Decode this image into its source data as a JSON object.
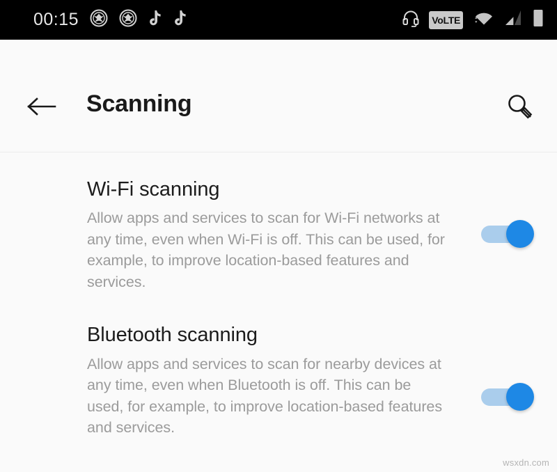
{
  "status_bar": {
    "clock": "00:15",
    "left_icons": [
      {
        "name": "shield-emblem-icon"
      },
      {
        "name": "shield-emblem-icon"
      },
      {
        "name": "tiktok-note-icon"
      },
      {
        "name": "tiktok-note-icon"
      }
    ],
    "right_icons": [
      {
        "name": "headset-icon"
      },
      {
        "name": "volte-badge",
        "label": "VoLTE"
      },
      {
        "name": "wifi-icon"
      },
      {
        "name": "cellular-signal-icon"
      },
      {
        "name": "battery-icon"
      }
    ],
    "background_color": "#000000",
    "foreground_color": "#e0e0e0"
  },
  "app_bar": {
    "back_label": "Back",
    "title": "Scanning",
    "search_label": "Search"
  },
  "settings": {
    "items": [
      {
        "title": "Wi-Fi scanning",
        "summary": "Allow apps and services to scan for Wi-Fi networks at any time, even when Wi-Fi is off. This can be used, for example, to improve location-based features and services.",
        "switch_state": "on"
      },
      {
        "title": "Bluetooth scanning",
        "summary": "Allow apps and services to scan for nearby devices at any time, even when Bluetooth is off. This can be used, for example, to improve location-based features and services.",
        "switch_state": "on"
      }
    ]
  },
  "watermark": "wsxdn.com",
  "colors": {
    "accent": "#1e88e5",
    "track_on": "#aacdec",
    "page_background": "#fafafa",
    "title_text": "#1c1c1c",
    "summary_text": "#9b9b9b"
  }
}
